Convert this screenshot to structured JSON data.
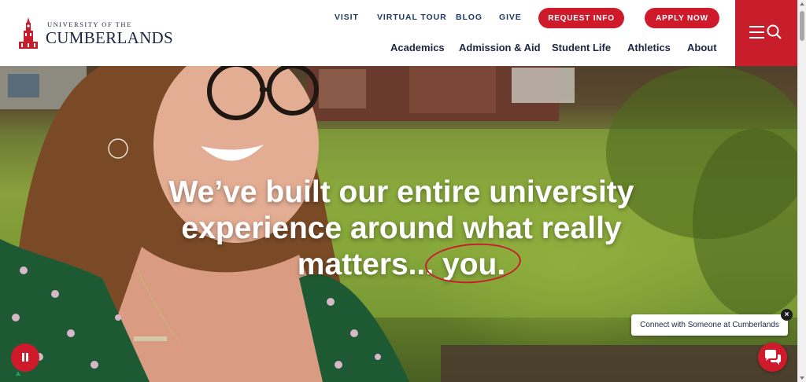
{
  "logo": {
    "line1": "UNIVERSITY OF THE",
    "line2": "CUMBERLANDS"
  },
  "utility_nav": {
    "visit": "VISIT",
    "virtual_tour": "VIRTUAL TOUR",
    "blog": "BLOG",
    "give": "GIVE",
    "request_info": "REQUEST INFO",
    "apply_now": "APPLY NOW"
  },
  "main_nav": {
    "academics": "Academics",
    "admission_aid": "Admission & Aid",
    "student_life": "Student Life",
    "athletics": "Athletics",
    "about": "About"
  },
  "menu": {
    "icons": [
      "hamburger-icon",
      "search-icon"
    ]
  },
  "hero": {
    "line1": "We’ve built our entire university",
    "line2": "experience around what really",
    "line3_prefix": "matters...",
    "line3_emphasis": "you."
  },
  "chat": {
    "prompt": "Connect with Someone at Cumberlands",
    "close_label": "×"
  },
  "colors": {
    "brand_red": "#cf1a2b",
    "navy": "#1c2541",
    "link_blue": "#1f3a68"
  }
}
